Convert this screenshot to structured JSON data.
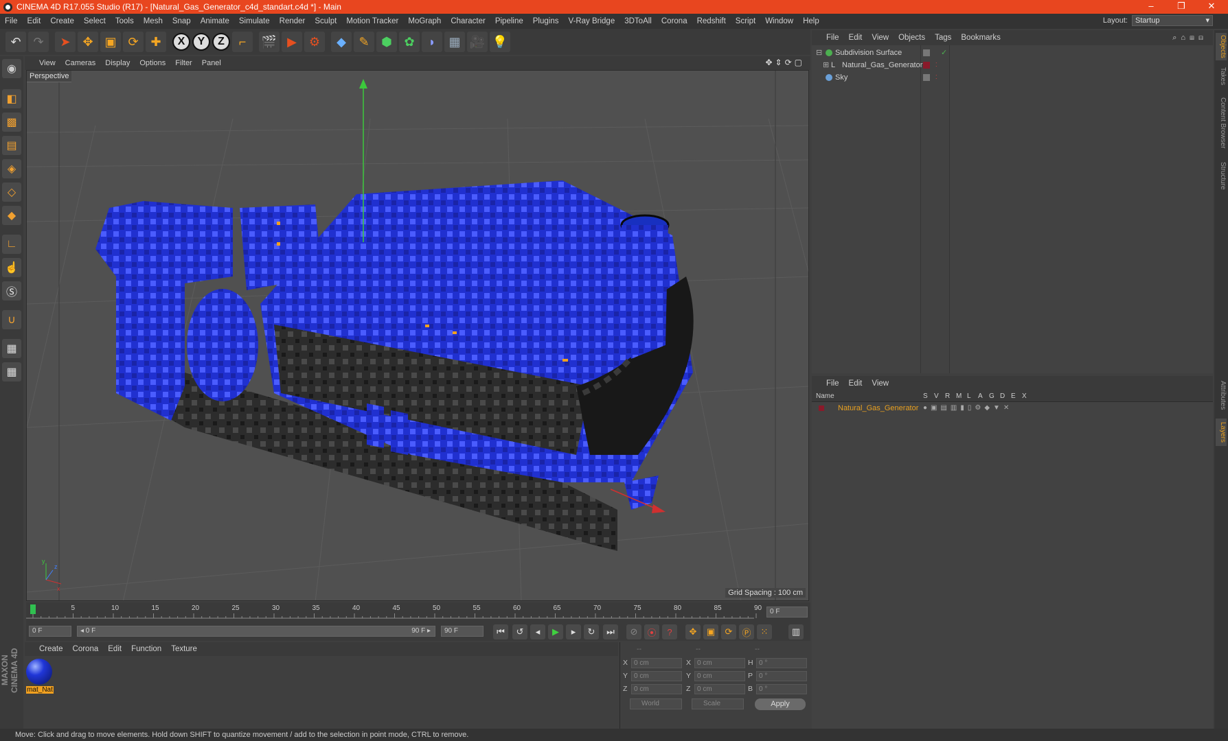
{
  "window": {
    "title": "CINEMA 4D R17.055 Studio (R17) - [Natural_Gas_Generator_c4d_standart.c4d *] - Main",
    "controls": [
      "–",
      "❐",
      "✕"
    ]
  },
  "menubar": {
    "items": [
      "File",
      "Edit",
      "Create",
      "Select",
      "Tools",
      "Mesh",
      "Snap",
      "Animate",
      "Simulate",
      "Render",
      "Sculpt",
      "Motion Tracker",
      "MoGraph",
      "Character",
      "Pipeline",
      "Plugins",
      "V-Ray Bridge",
      "3DToAll",
      "Corona",
      "Redshift",
      "Script",
      "Window",
      "Help"
    ],
    "layout_label": "Layout:",
    "layout_value": "Startup"
  },
  "toolbar": {
    "axis_labels": [
      "X",
      "Y",
      "Z"
    ]
  },
  "viewport": {
    "menu": [
      "View",
      "Cameras",
      "Display",
      "Options",
      "Filter",
      "Panel"
    ],
    "label": "Perspective",
    "grid_spacing": "Grid Spacing : 100 cm"
  },
  "timeline": {
    "ticks": [
      "0",
      "5",
      "10",
      "15",
      "20",
      "25",
      "30",
      "35",
      "40",
      "45",
      "50",
      "55",
      "60",
      "65",
      "70",
      "75",
      "80",
      "85",
      "90"
    ],
    "current_frame": "0 F",
    "start_field": "0 F",
    "range_start": "◂ 0 F",
    "range_end": "90 F ▸",
    "end_field": "90 F"
  },
  "materials": {
    "menu": [
      "Create",
      "Corona",
      "Edit",
      "Function",
      "Texture"
    ],
    "items": [
      {
        "name": "mat_Nat"
      }
    ]
  },
  "coordinates": {
    "header": [
      "--",
      "--",
      "--"
    ],
    "rows": [
      {
        "a": "X",
        "av": "0 cm",
        "b": "X",
        "bv": "0 cm",
        "c": "H",
        "cv": "0 °"
      },
      {
        "a": "Y",
        "av": "0 cm",
        "b": "Y",
        "bv": "0 cm",
        "c": "P",
        "cv": "0 °"
      },
      {
        "a": "Z",
        "av": "0 cm",
        "b": "Z",
        "bv": "0 cm",
        "c": "B",
        "cv": "0 °"
      }
    ],
    "world": "World",
    "scale": "Scale",
    "apply": "Apply"
  },
  "objects": {
    "menu": [
      "File",
      "Edit",
      "View",
      "Objects",
      "Tags",
      "Bookmarks"
    ],
    "items": [
      {
        "name": "Subdivision Surface",
        "color": "#4caf50"
      },
      {
        "name": "Natural_Gas_Generator",
        "color": "#9a9a9a"
      },
      {
        "name": "Sky",
        "color": "#6aa0d8"
      }
    ]
  },
  "layers": {
    "menu": [
      "File",
      "Edit",
      "View"
    ],
    "columns": [
      "Name",
      "S",
      "V",
      "R",
      "M",
      "L",
      "A",
      "G",
      "D",
      "E",
      "X"
    ],
    "items": [
      {
        "name": "Natural_Gas_Generator",
        "color": "#e8a020"
      }
    ]
  },
  "right_tabs": [
    "Objects",
    "Takes",
    "Content Browser",
    "Structure",
    "Attributes",
    "Layers"
  ],
  "branding": "MAXON CINEMA 4D",
  "status": "Move: Click and drag to move elements. Hold down SHIFT to quantize movement / add to the selection in point mode, CTRL to remove."
}
